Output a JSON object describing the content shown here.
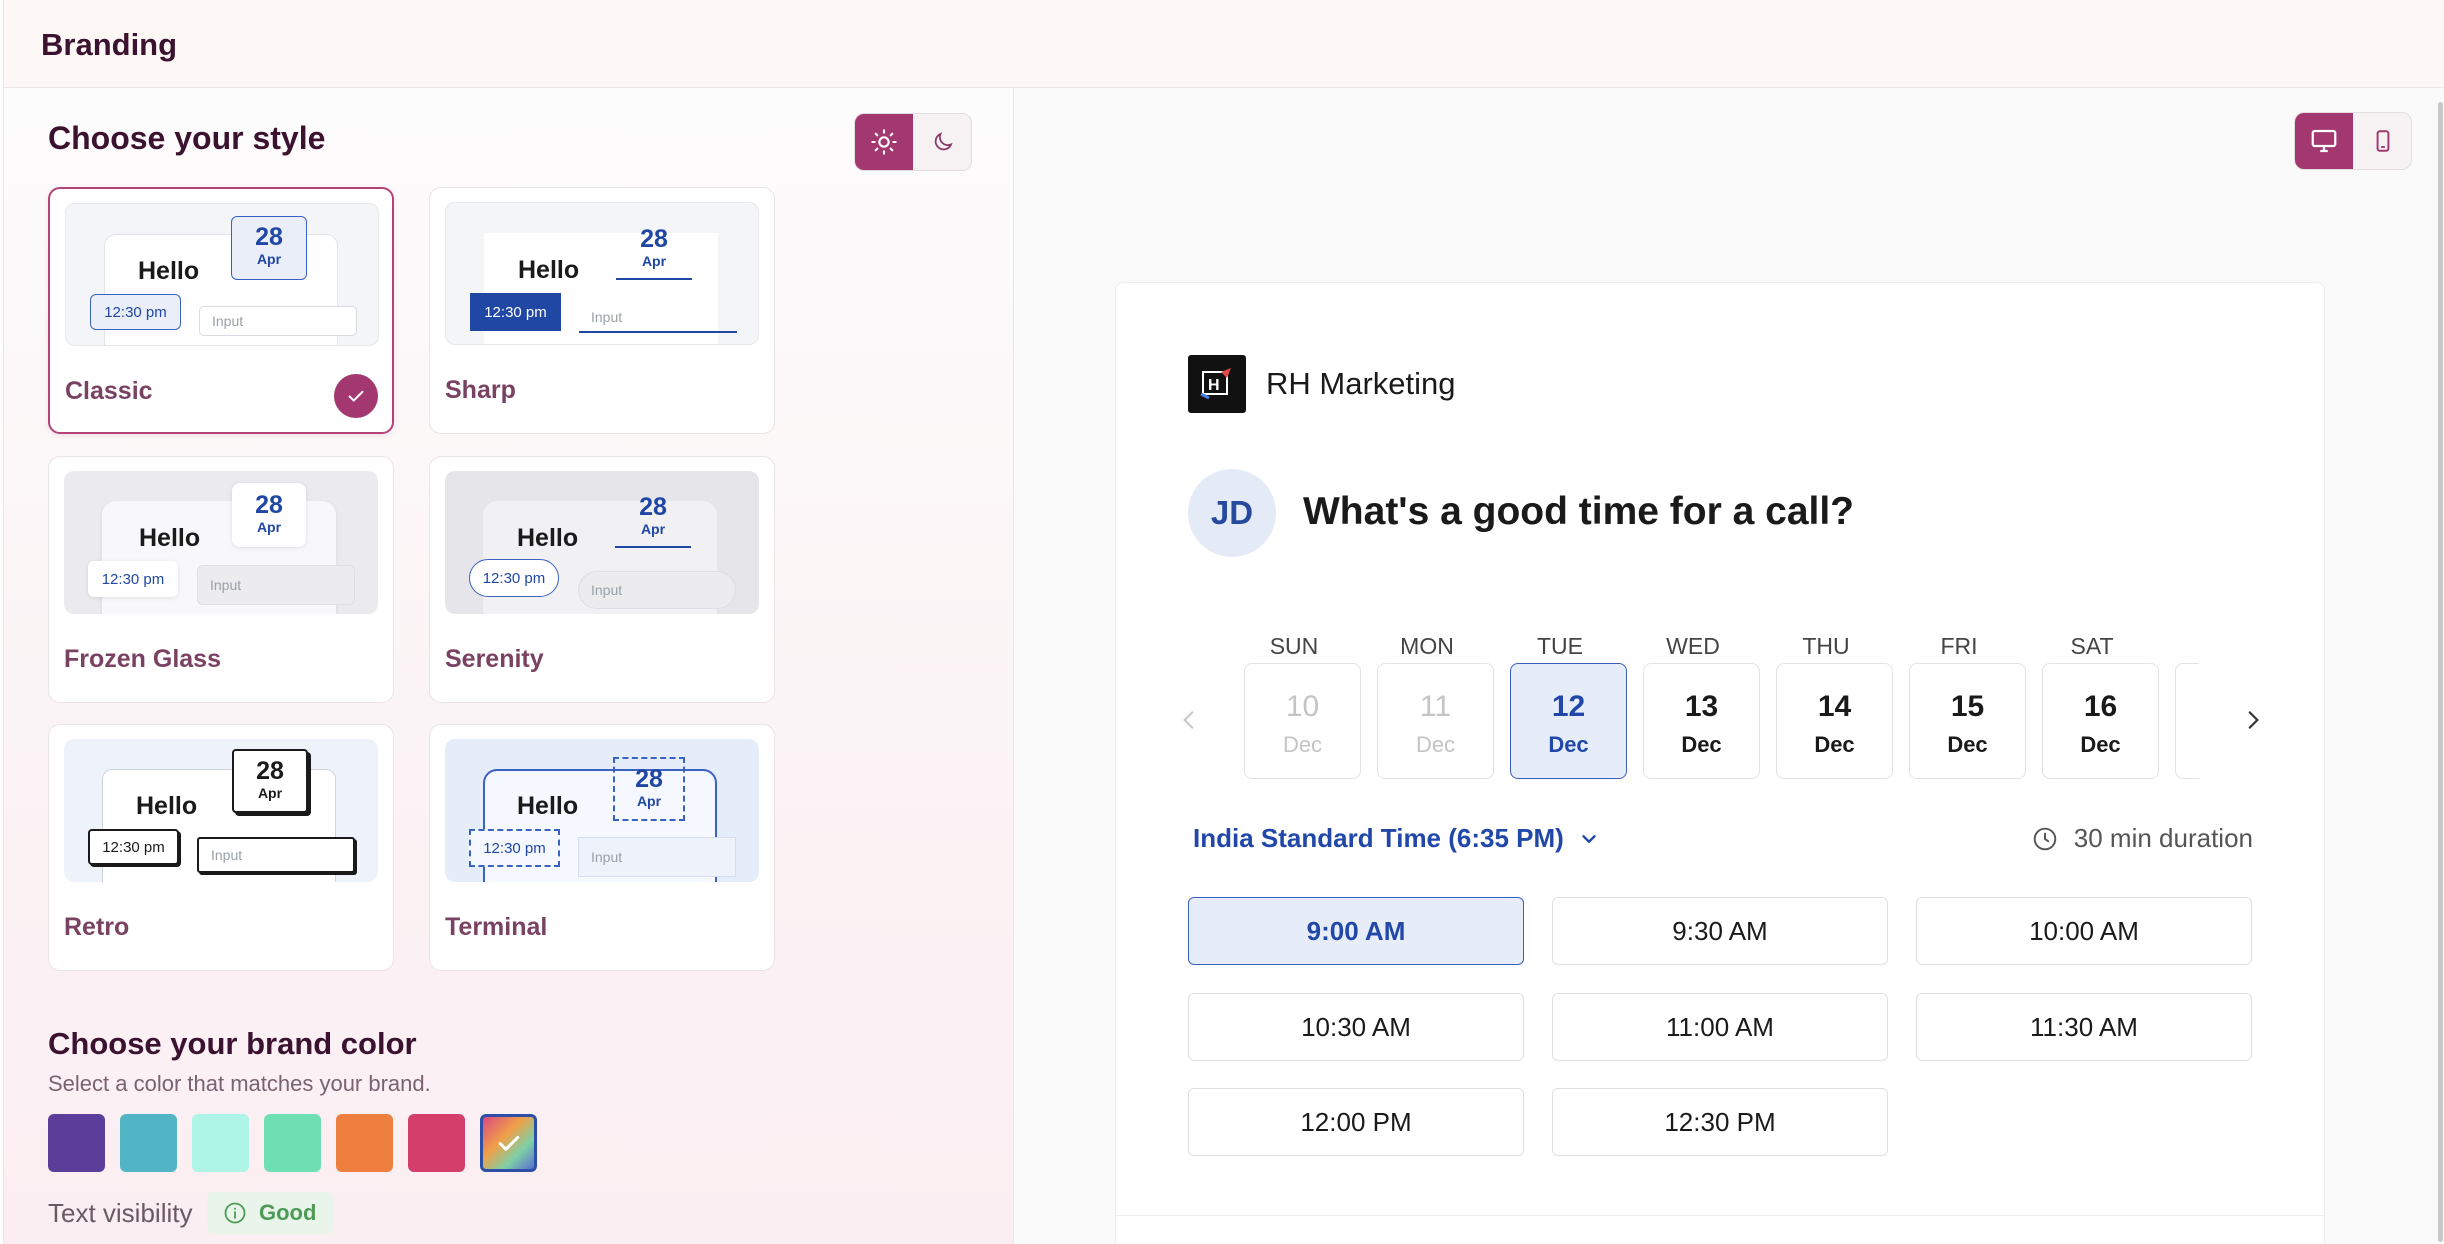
{
  "header": {
    "title": "Branding"
  },
  "style_section": {
    "title": "Choose your style",
    "selected": "Classic",
    "theme_modes": {
      "light_icon": "sun-icon",
      "dark_icon": "moon-icon",
      "active": "light"
    },
    "preview": {
      "hello": "Hello",
      "day": "28",
      "month": "Apr",
      "time": "12:30 pm",
      "input": "Input"
    },
    "styles": [
      {
        "name": "Classic"
      },
      {
        "name": "Sharp"
      },
      {
        "name": "Frozen Glass"
      },
      {
        "name": "Serenity"
      },
      {
        "name": "Retro"
      },
      {
        "name": "Terminal"
      }
    ]
  },
  "brand_color": {
    "title": "Choose your brand color",
    "subtitle": "Select a color that matches your brand.",
    "colors": [
      "#5b3e99",
      "#52b5c5",
      "#aef5e8",
      "#6fe0b3",
      "#ee7f3f",
      "#d43e6b",
      "gradient"
    ],
    "selected_index": 6,
    "visibility_label": "Text visibility",
    "visibility_status": "Good"
  },
  "preview": {
    "device_modes": {
      "desktop_icon": "monitor-icon",
      "mobile_icon": "phone-icon",
      "active": "desktop"
    },
    "org_name": "RH Marketing",
    "avatar_initials": "JD",
    "question": "What's a good time for a call?",
    "weekdays": [
      "SUN",
      "MON",
      "TUE",
      "WED",
      "THU",
      "FRI",
      "SAT"
    ],
    "days": [
      {
        "num": "10",
        "month": "Dec",
        "state": "disabled"
      },
      {
        "num": "11",
        "month": "Dec",
        "state": "disabled"
      },
      {
        "num": "12",
        "month": "Dec",
        "state": "selected"
      },
      {
        "num": "13",
        "month": "Dec",
        "state": "normal"
      },
      {
        "num": "14",
        "month": "Dec",
        "state": "normal"
      },
      {
        "num": "15",
        "month": "Dec",
        "state": "normal"
      },
      {
        "num": "16",
        "month": "Dec",
        "state": "normal"
      }
    ],
    "timezone": "India Standard Time (6:35 PM)",
    "duration": "30 min duration",
    "slots": [
      "9:00 AM",
      "9:30 AM",
      "10:00 AM",
      "10:30 AM",
      "11:00 AM",
      "11:30 AM",
      "12:00 PM",
      "12:30 PM"
    ],
    "selected_slot": "9:00 AM"
  },
  "colors": {
    "accent": "#a3376f",
    "selected_blue": "#2148a8"
  }
}
